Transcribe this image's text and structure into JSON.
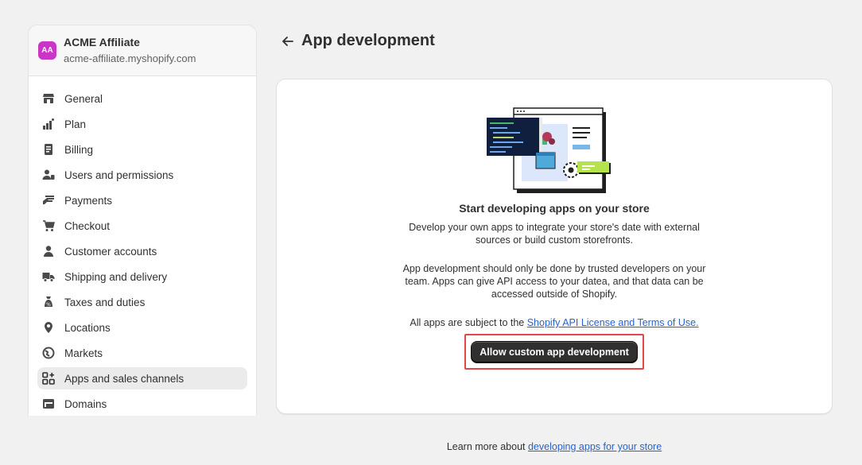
{
  "store": {
    "initials": "AA",
    "name": "ACME Affiliate",
    "domain": "acme-affiliate.myshopify.com"
  },
  "nav": {
    "items": [
      {
        "label": "General",
        "icon": "store-icon"
      },
      {
        "label": "Plan",
        "icon": "plan-icon"
      },
      {
        "label": "Billing",
        "icon": "billing-icon"
      },
      {
        "label": "Users and permissions",
        "icon": "users-icon"
      },
      {
        "label": "Payments",
        "icon": "payments-icon"
      },
      {
        "label": "Checkout",
        "icon": "cart-icon"
      },
      {
        "label": "Customer accounts",
        "icon": "person-icon"
      },
      {
        "label": "Shipping and delivery",
        "icon": "truck-icon"
      },
      {
        "label": "Taxes and duties",
        "icon": "tax-bag-icon"
      },
      {
        "label": "Locations",
        "icon": "location-pin-icon"
      },
      {
        "label": "Markets",
        "icon": "globe-icon"
      },
      {
        "label": "Apps and sales channels",
        "icon": "apps-icon",
        "active": true
      },
      {
        "label": "Domains",
        "icon": "domains-icon"
      }
    ]
  },
  "page": {
    "title": "App development"
  },
  "card": {
    "title": "Start developing apps on your store",
    "text1_line1": "Develop your own apps to integrate your store's date with external",
    "text1_line2": "sources or build custom storefronts.",
    "text2_line1": "App development should only be done by trusted developers on your",
    "text2_line2": "team. Apps can give API access to your datea, and that data can be",
    "text2_line3": "accessed outside of Shopify.",
    "terms_prefix": "All apps are subject to the ",
    "terms_link": "Shopify API License and Terms of Use.",
    "button_label": "Allow custom app development"
  },
  "footer": {
    "prefix": "Learn more about ",
    "link": "developing apps for your store"
  },
  "colors": {
    "avatar": "#c935c5",
    "link": "#2463d1",
    "button": "#303030",
    "highlight": "#e04848"
  }
}
